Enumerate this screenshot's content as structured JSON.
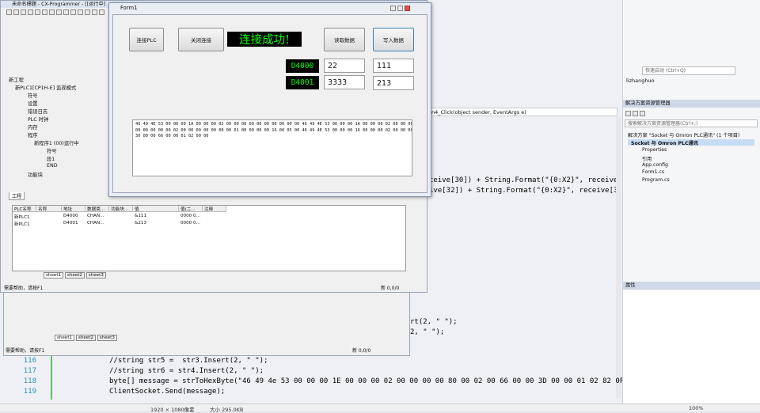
{
  "window": {
    "title": "未命名標題 - CX-Programmer - [[运行中]"
  },
  "form": {
    "title": "Form1",
    "btn_connect": "连接PLC",
    "btn_close": "关闭连接",
    "status": "连接成功!",
    "btn_read": "读取数据",
    "btn_write": "写入数据",
    "rows": [
      {
        "addr": "D4000",
        "read": "22",
        "write": "111"
      },
      {
        "addr": "D4001",
        "read": "3333",
        "write": "213"
      }
    ],
    "hex_lines": [
      "46 49 4E 53 00 00 00 1A 00 00 00 02 00 00 00 00 00 00 00 00 00 00 46 49 4E 53 00 00 00 1A 00 00 00 02 00 00 00 00 00 00 00 00 00 00",
      "00 00 00 00 00 02 00 00 00 00 00 00 00 01 00 00 00 00 16 00 05 00 46 49 4E 53 00 00 00 16 00 00 00 02 00 00 00 00 00 00 00 00 00 00",
      "30 00 00 66 00 00 01 02 00 00"
    ]
  },
  "tree": {
    "items": [
      "新工程",
      "新PLC1[CP1H-E] 监视模式",
      "符号",
      "设置",
      "错误日志",
      "PLC 时钟",
      "内存",
      "程序",
      "新程序1 (00)运行中",
      "符号",
      "段1",
      "END",
      "功能块"
    ],
    "tab": "工程"
  },
  "watch": {
    "headers": [
      "PLC名称",
      "名称",
      "地址",
      "数据类...",
      "功能块...",
      "值",
      "值(二...",
      "注释"
    ],
    "rows": [
      [
        "新PLC1",
        "",
        "D4000",
        "CHAN...",
        "",
        "&111",
        "0000 0...",
        ""
      ],
      [
        "新PLC1",
        "",
        "D4001",
        "CHAN...",
        "",
        "&213",
        "0000 0...",
        ""
      ]
    ],
    "sheets": [
      "sheet1",
      "sheet2",
      "sheet3"
    ],
    "status_left": "需要帮助，请按F1",
    "status_right": "新 0,0/0"
  },
  "code": {
    "header": "n4_Click(object sender, EventArgs e)",
    "line_a": "ceive[30]) + String.Format(\"{0:X2}\", receive",
    "line_b": "ive[32]) + String.Format(\"{0:X2}\", receive[3",
    "line_c": "rt(2, \" \");",
    "line_d": "2, \" \");",
    "lines": [
      {
        "n": "116",
        "t": "//string str5 =  str3.Insert(2, \" \");"
      },
      {
        "n": "117",
        "t": "//string str6 = str4.Insert(2, \" \");"
      },
      {
        "n": "118",
        "t": "byte[] message = strToHexByte(\"46 49 4e 53 00 00 00 1E 00 00 00 02 00 00 00 00 80 00 02 00 66 00 00 3D 00 00 01 02 82 0F A0"
      },
      {
        "n": "119",
        "t": "ClientSocket.Send(message);"
      }
    ]
  },
  "vs": {
    "quick_launch": "快速启动 (Ctrl+Q)",
    "user": "lizhanghuo",
    "solution_explorer": "解决方案资源管理器",
    "search": "搜索解决方案资源管理器(Ctrl+;)",
    "solution": "解决方案 \"Socket 与 Omron PLC通讯\" (1 个项目)",
    "project": "Socket 与 Omron PLC通讯",
    "items": [
      "Properties",
      "引用",
      "App.config",
      "Form1.cs",
      "Program.cs"
    ],
    "properties": "属性"
  },
  "status": {
    "resolution": "1920 × 1080像素",
    "size": "大小 295.0KB",
    "zoom": "100%"
  }
}
